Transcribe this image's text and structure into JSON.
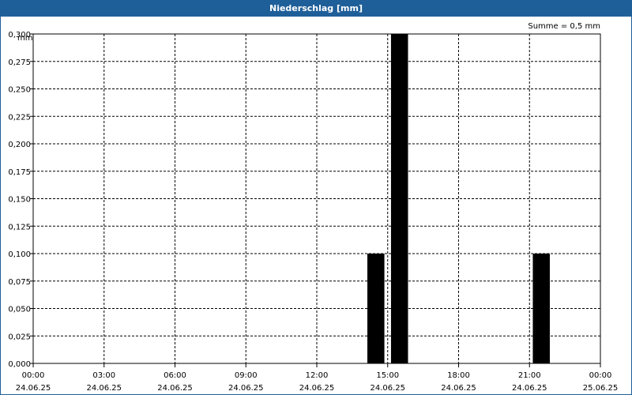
{
  "window": {
    "title": "Niederschlag [mm]"
  },
  "chart_data": {
    "type": "bar",
    "title": "Niederschlag [mm]",
    "unit_label": "mm",
    "sum_label": "Summe = 0,5 mm",
    "ylim": [
      0,
      0.3
    ],
    "y_ticks": [
      "0,000",
      "0,025",
      "0,050",
      "0,075",
      "0,100",
      "0,125",
      "0,150",
      "0,175",
      "0,200",
      "0,225",
      "0,250",
      "0,275",
      "0,300"
    ],
    "x_range_hours": [
      0,
      24
    ],
    "x_ticks": [
      {
        "time": "00:00",
        "date": "24.06.25"
      },
      {
        "time": "03:00",
        "date": "24.06.25"
      },
      {
        "time": "06:00",
        "date": "24.06.25"
      },
      {
        "time": "09:00",
        "date": "24.06.25"
      },
      {
        "time": "12:00",
        "date": "24.06.25"
      },
      {
        "time": "15:00",
        "date": "24.06.25"
      },
      {
        "time": "18:00",
        "date": "24.06.25"
      },
      {
        "time": "21:00",
        "date": "24.06.25"
      },
      {
        "time": "00:00",
        "date": "25.06.25"
      }
    ],
    "bars": [
      {
        "start": "14:00",
        "end": "15:00",
        "value": 0.1
      },
      {
        "start": "15:00",
        "end": "16:00",
        "value": 0.3
      },
      {
        "start": "21:00",
        "end": "22:00",
        "value": 0.1
      }
    ],
    "grid": true
  }
}
